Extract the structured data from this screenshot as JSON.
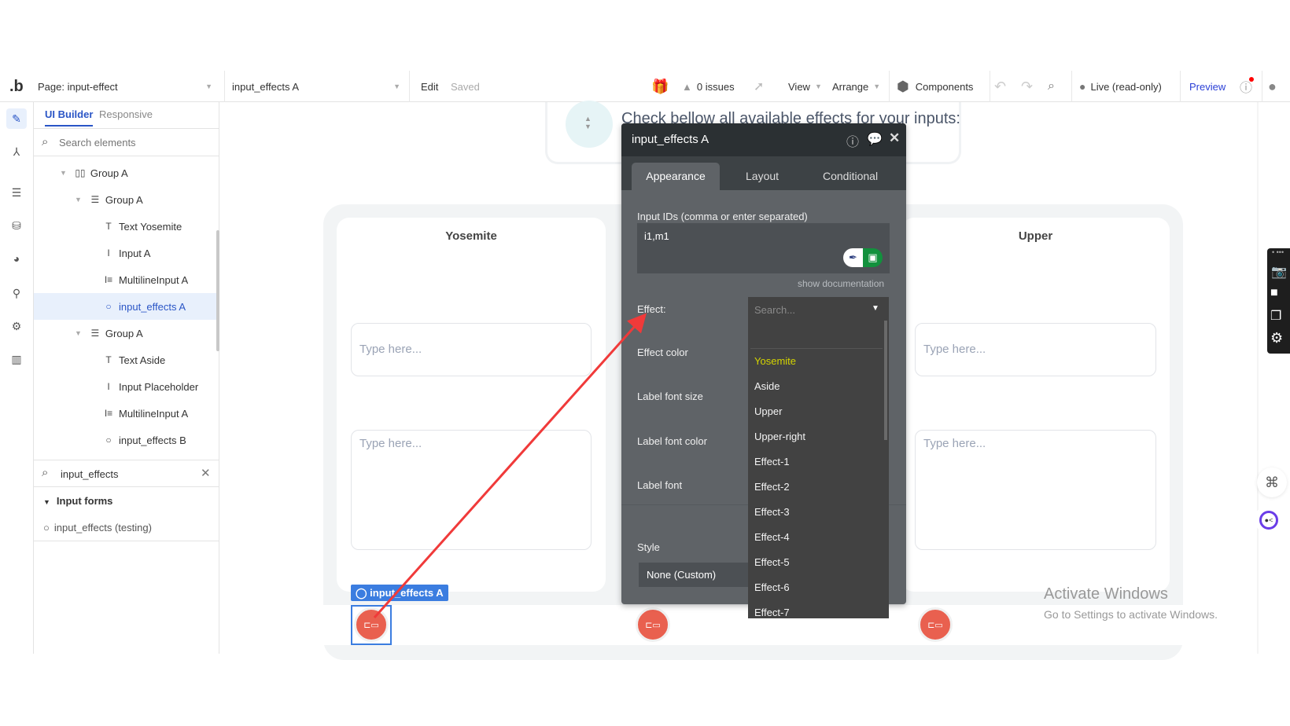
{
  "topbar": {
    "logo": ".b",
    "page_label": "Page: input-effect",
    "element_select": "input_effects A",
    "edit": "Edit",
    "saved": "Saved",
    "issues": "0 issues",
    "view": "View",
    "arrange": "Arrange",
    "components": "Components",
    "live": "Live (read-only)",
    "preview": "Preview"
  },
  "panel": {
    "tabs": [
      "UI Builder",
      "Responsive"
    ],
    "search_placeholder": "Search elements",
    "tree": [
      {
        "label": "Group A",
        "icon": "columns-icon"
      },
      {
        "label": "Group A",
        "icon": "rows-icon"
      },
      {
        "label": "Text Yosemite",
        "icon": "text-icon"
      },
      {
        "label": "Input A",
        "icon": "input-icon"
      },
      {
        "label": "MultilineInput A",
        "icon": "multiline-icon"
      },
      {
        "label": "input_effects A",
        "icon": "plugin-circle-icon"
      },
      {
        "label": "Group A",
        "icon": "rows-icon"
      },
      {
        "label": "Text Aside",
        "icon": "text-icon"
      },
      {
        "label": "Input Placeholder",
        "icon": "input-icon"
      },
      {
        "label": "MultilineInput A",
        "icon": "multiline-icon"
      },
      {
        "label": "input_effects B",
        "icon": "plugin-circle-icon"
      }
    ],
    "search_value": "input_effects",
    "section": "Input forms",
    "result": "input_effects (testing)"
  },
  "canvas": {
    "header": "Check bellow all available effects for your inputs:",
    "card1_title": "Yosemite",
    "card2_title": "Upper",
    "placeholder": "Type here...",
    "selected_tag": "input_effects A"
  },
  "prop": {
    "title": "input_effects A",
    "tabs": [
      "Appearance",
      "Layout",
      "Conditional"
    ],
    "ids_label": "Input IDs (comma or enter separated)",
    "ids_value": "i1,m1",
    "show_doc": "show documentation",
    "effect_label": "Effect:",
    "effect_color": "Effect color",
    "label_font_size": "Label font size",
    "label_font_color": "Label font color",
    "label_font": "Label font",
    "style_label": "Style",
    "style_value": "None (Custom)"
  },
  "dropdown": {
    "placeholder": "Search...",
    "options": [
      "Yosemite",
      "Aside",
      "Upper",
      "Upper-right",
      "Effect-1",
      "Effect-2",
      "Effect-3",
      "Effect-4",
      "Effect-5",
      "Effect-6",
      "Effect-7"
    ],
    "highlight_color": "#d4d400"
  },
  "watermark": {
    "line1": "Activate Windows",
    "line2": "Go to Settings to activate Windows."
  },
  "colors": {
    "accent": "#2a55c6",
    "selection": "#3b7de0",
    "button": "#e9604f",
    "annotation_arrow": "#f03a3a"
  }
}
